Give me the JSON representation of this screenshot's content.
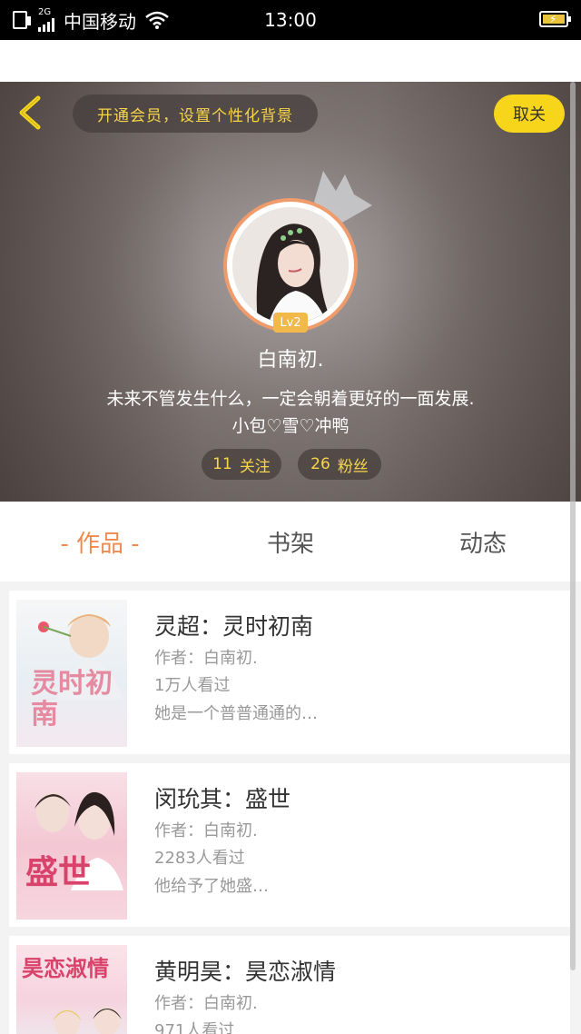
{
  "status_bar": {
    "network": "2G",
    "carrier": "中国移动",
    "time": "13:00",
    "battery_color": "#e8c53a"
  },
  "header": {
    "back_icon": "chevron-left-icon",
    "vip_banner": "开通会员，设置个性化背景",
    "unfollow_label": "取关",
    "level": "Lv2",
    "username": "白南初.",
    "bio_line1": "未来不管发生什么，一定会朝着更好的一面发展.",
    "bio_line2": "小包♡雪♡冲鸭",
    "following_count": "11",
    "following_label": "关注",
    "fans_count": "26",
    "fans_label": "粉丝"
  },
  "tabs": [
    {
      "label": "- 作品 -",
      "active": true
    },
    {
      "label": "书架",
      "active": false
    },
    {
      "label": "动态",
      "active": false
    }
  ],
  "books": [
    {
      "title": "灵超：灵时初南",
      "author": "作者：白南初.",
      "views": "1万人看过",
      "desc": "她是一个普普通通的…",
      "cover_text": "灵时初南"
    },
    {
      "title": "闵玧其：盛世",
      "author": "作者：白南初.",
      "views": "2283人看过",
      "desc": "他给予了她盛…",
      "cover_text": "盛世"
    },
    {
      "title": "黄明昊：昊恋淑情",
      "author": "作者：白南初.",
      "views": "971人看过",
      "desc": "",
      "cover_text": "昊恋淑情"
    }
  ],
  "colors": {
    "accent": "#f7d51a",
    "active_tab": "#ef8a4f",
    "avatar_ring": "#f09b6b"
  }
}
